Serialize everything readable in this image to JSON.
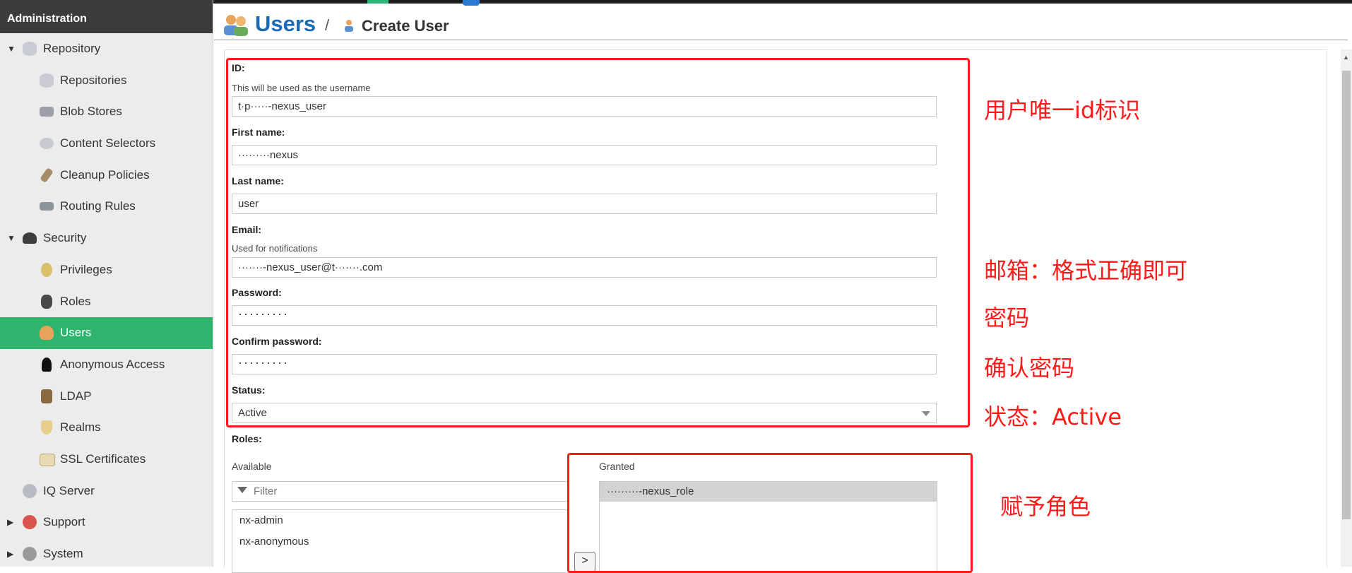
{
  "sidebar": {
    "header": "Administration",
    "items": [
      {
        "label": "Repository"
      },
      {
        "label": "Repositories"
      },
      {
        "label": "Blob Stores"
      },
      {
        "label": "Content Selectors"
      },
      {
        "label": "Cleanup Policies"
      },
      {
        "label": "Routing Rules"
      },
      {
        "label": "Security"
      },
      {
        "label": "Privileges"
      },
      {
        "label": "Roles"
      },
      {
        "label": "Users"
      },
      {
        "label": "Anonymous Access"
      },
      {
        "label": "LDAP"
      },
      {
        "label": "Realms"
      },
      {
        "label": "SSL Certificates"
      },
      {
        "label": "IQ Server"
      },
      {
        "label": "Support"
      },
      {
        "label": "System"
      }
    ],
    "active_color": "#2fb46e"
  },
  "breadcrumb": {
    "root": "Users",
    "separator": "/",
    "current": "Create User"
  },
  "form": {
    "id": {
      "label": "ID:",
      "help": "This will be used as the username",
      "value": "t·p·····-nexus_user"
    },
    "first_name": {
      "label": "First name:",
      "value": "·········nexus"
    },
    "last_name": {
      "label": "Last name:",
      "value": "user"
    },
    "email": {
      "label": "Email:",
      "help": "Used for notifications",
      "value": "·······-nexus_user@t·······.com"
    },
    "password": {
      "label": "Password:",
      "value": "·········"
    },
    "confirm_password": {
      "label": "Confirm password:",
      "value": "·········"
    },
    "status": {
      "label": "Status:",
      "value": "Active"
    },
    "roles": {
      "label": "Roles:",
      "available_label": "Available",
      "granted_label": "Granted",
      "filter_placeholder": "Filter",
      "available": [
        "nx-admin",
        "nx-anonymous"
      ],
      "granted": [
        "·········-nexus_role"
      ],
      "move_button": ">"
    }
  },
  "annotations": {
    "id_note": "用户唯一id标识",
    "email_note": "邮箱：格式正确即可",
    "password_note": "密码",
    "confirm_note": "确认密码",
    "status_note": "状态：Active",
    "roles_note": "赋予角色",
    "color": "#ff1a1a"
  }
}
